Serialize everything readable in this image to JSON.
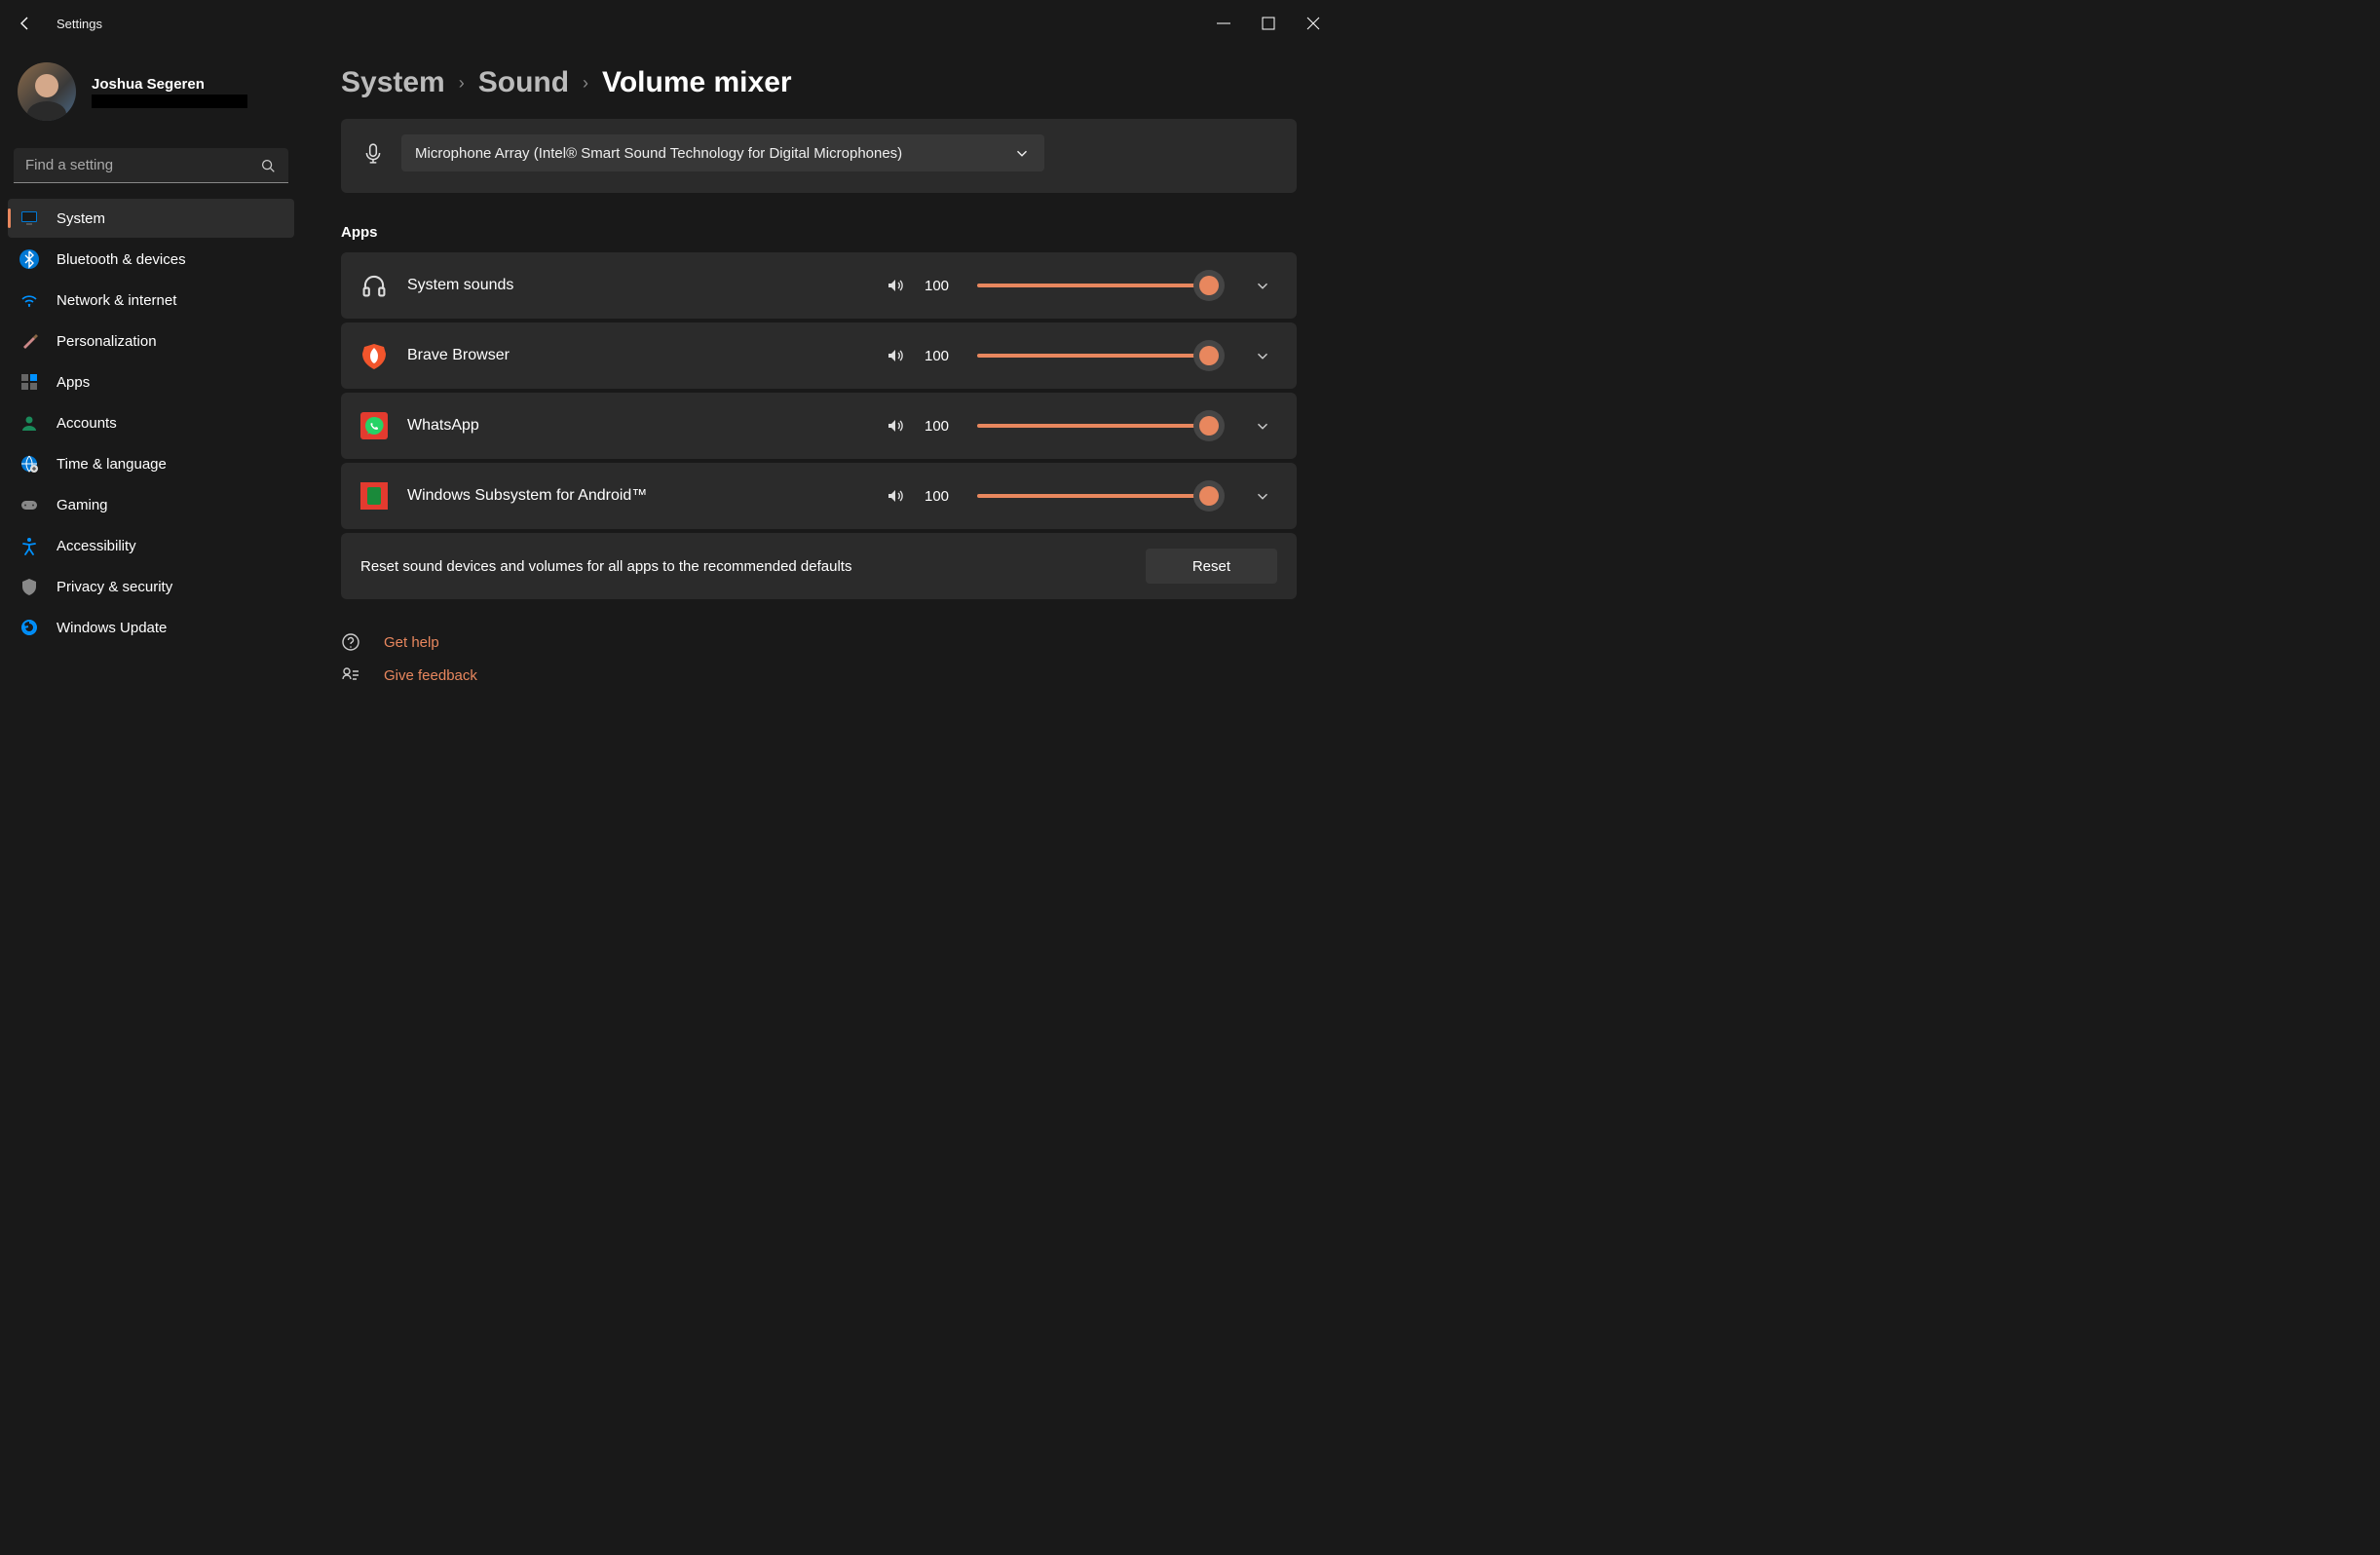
{
  "app_title": "Settings",
  "profile": {
    "name": "Joshua Segeren"
  },
  "search": {
    "placeholder": "Find a setting"
  },
  "nav": [
    {
      "label": "System",
      "icon": "monitor",
      "active": true
    },
    {
      "label": "Bluetooth & devices",
      "icon": "bluetooth"
    },
    {
      "label": "Network & internet",
      "icon": "wifi"
    },
    {
      "label": "Personalization",
      "icon": "brush"
    },
    {
      "label": "Apps",
      "icon": "apps"
    },
    {
      "label": "Accounts",
      "icon": "person"
    },
    {
      "label": "Time & language",
      "icon": "globe"
    },
    {
      "label": "Gaming",
      "icon": "gamepad"
    },
    {
      "label": "Accessibility",
      "icon": "accessibility"
    },
    {
      "label": "Privacy & security",
      "icon": "shield"
    },
    {
      "label": "Windows Update",
      "icon": "update"
    }
  ],
  "breadcrumb": {
    "level1": "System",
    "level2": "Sound",
    "current": "Volume mixer"
  },
  "input_device": {
    "selected": "Microphone Array (Intel® Smart Sound Technology for Digital Microphones)"
  },
  "apps_section_title": "Apps",
  "apps": [
    {
      "name": "System sounds",
      "icon": "headphones",
      "volume": 100
    },
    {
      "name": "Brave Browser",
      "icon": "brave",
      "volume": 100
    },
    {
      "name": "WhatsApp",
      "icon": "whatsapp",
      "volume": 100
    },
    {
      "name": "Windows Subsystem for Android™",
      "icon": "wsa",
      "volume": 100
    }
  ],
  "reset": {
    "text": "Reset sound devices and volumes for all apps to the recommended defaults",
    "button": "Reset"
  },
  "help": {
    "get_help": "Get help",
    "feedback": "Give feedback"
  }
}
